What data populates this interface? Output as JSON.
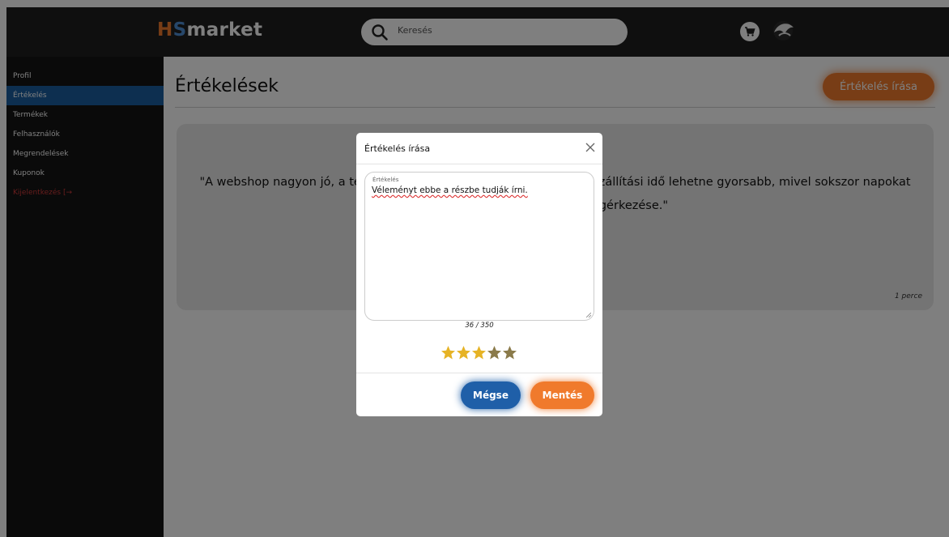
{
  "header": {
    "logo_hs_1": "H",
    "logo_hs_2": "S",
    "logo_rest": "market",
    "search_placeholder": "Keresés",
    "cart_icon": "cart-icon",
    "avatar_icon": "user-avatar"
  },
  "sidebar": {
    "items": [
      {
        "label": "Profil"
      },
      {
        "label": "Értékelés"
      },
      {
        "label": "Termékek"
      },
      {
        "label": "Felhasználók"
      },
      {
        "label": "Megrendelések"
      },
      {
        "label": "Kuponok"
      },
      {
        "label": "Kijelentkezés [→"
      }
    ],
    "active_index": 1
  },
  "main": {
    "title": "Értékelések",
    "write_button": "Értékelés írása",
    "review": {
      "text": "\"A webshop nagyon jó, a termékek minősége is remek. Azonban a szállítási idő lehetne gyorsabb, mivel sokszor napokat vett igénybe a csomag megérkezése.\"",
      "time": "1 perce"
    }
  },
  "modal": {
    "title": "Értékelés írása",
    "field_label": "Értékelés",
    "field_value": "Véleményt ebbe a részbe tudják írni.",
    "counter": "36 / 350",
    "rating": 3,
    "max_rating": 5,
    "cancel_label": "Mégse",
    "save_label": "Mentés"
  },
  "colors": {
    "accent_orange": "#f07a2c",
    "accent_blue": "#1f5fa8",
    "star_filled": "#e6b325",
    "star_empty": "#8a7a4a",
    "logout_red": "#d03a3a"
  }
}
